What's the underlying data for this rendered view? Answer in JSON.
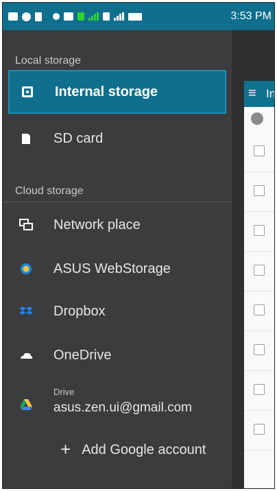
{
  "status_bar": {
    "time": "3:53 PM"
  },
  "drawer": {
    "local_storage_header": "Local storage",
    "internal_storage": "Internal storage",
    "sd_card": "SD card",
    "cloud_storage_header": "Cloud storage",
    "network_place": "Network place",
    "asus_webstorage": "ASUS WebStorage",
    "dropbox": "Dropbox",
    "onedrive": "OneDrive",
    "drive_label": "Drive",
    "drive_account": "asus.zen.ui@gmail.com",
    "add_google_account": "Add Google account",
    "plus_glyph": "+"
  },
  "content": {
    "toolbar_title": "In",
    "menu_glyph": "≡"
  },
  "colors": {
    "status_bar": "#0f6f8d",
    "drawer_bg": "#3b3c3e",
    "active_item": "#0f6f8d",
    "accent_orange": "#e8a93d"
  }
}
